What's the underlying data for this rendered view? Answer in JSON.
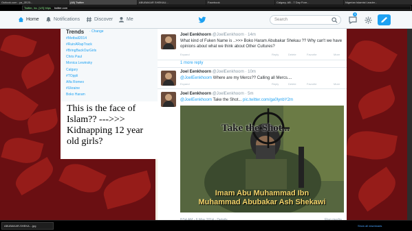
{
  "browser": {
    "tabs": [
      "Outlook.com - ya_ZE23...",
      "(48) Twitter",
      "ABUBAKAR SHEKAU...",
      "Facebook",
      "Calgary, AB - 7 Day Fore...",
      "Nigerian Islamist Leader..."
    ],
    "address_scheme": "Twitter, Inc. [US]",
    "address_url": "https",
    "address_site": "twitter.com"
  },
  "nav": {
    "home": "Home",
    "notifications": "Notifications",
    "discover": "Discover",
    "me": "Me",
    "search_placeholder": "Search",
    "messages_badge": "3"
  },
  "trends": {
    "title": "Trends",
    "change": "· Change",
    "items": [
      "#Metball2014",
      "#RuinARapTrack",
      "#BringBackOurGirls",
      "Chris Paul",
      "Monica Lewinsky",
      "Calgary",
      "#TOppli",
      "Alfa Romeo",
      "#Ukraine",
      "Boko Haram"
    ]
  },
  "caption": {
    "line1": "This is the face of Islam??  --->>>",
    "line2": "Kidnapping 12 year old girls?"
  },
  "tweets": [
    {
      "name": "Joel Eenkhoorn",
      "handle": "@JoelEenkhoorn · 14m",
      "text": "What kind of Fuken  Name is ..>>> Boko Haram Abubakar Shekau  ?? Why can't we have opinions about what we think about Other Cultures?",
      "expand": "Expand",
      "reply": "Reply",
      "delete": "Delete",
      "favorite": "Favorite",
      "more": "More"
    },
    {
      "name": "Joel Eenkhoorn",
      "handle": "@JoelEenkhoorn · 10m",
      "mention": "@JoelEenkhoorn",
      "text": " Where are my Mercs?? Calling all Mercs....",
      "expand": "Expand",
      "reply": "Reply",
      "delete": "Delete",
      "favorite": "Favorite",
      "more": "More"
    },
    {
      "name": "Joel Eenkhoorn",
      "handle": "@JoelEenkhoorn · 5m",
      "mention": "@JoelEenkhoorn",
      "text": " Take the Shot... ",
      "link": "pic.twitter.com/ga0lynbY2m"
    }
  ],
  "more_reply": "1 more reply",
  "photo": {
    "take_the_shot": "Take the Shot...",
    "bottom_line1": "Imam Abu Muhammad Ibn",
    "bottom_line2": "Muhammad Abubakar Ash Shekawi"
  },
  "tweet_meta": "8:54 AM - 6 May 2014 · Details",
  "flag_media": "Flag media",
  "taskbar": {
    "item": "ABUBAKAR-SHEKA....jpg",
    "show_downloads": "Show all downloads"
  }
}
